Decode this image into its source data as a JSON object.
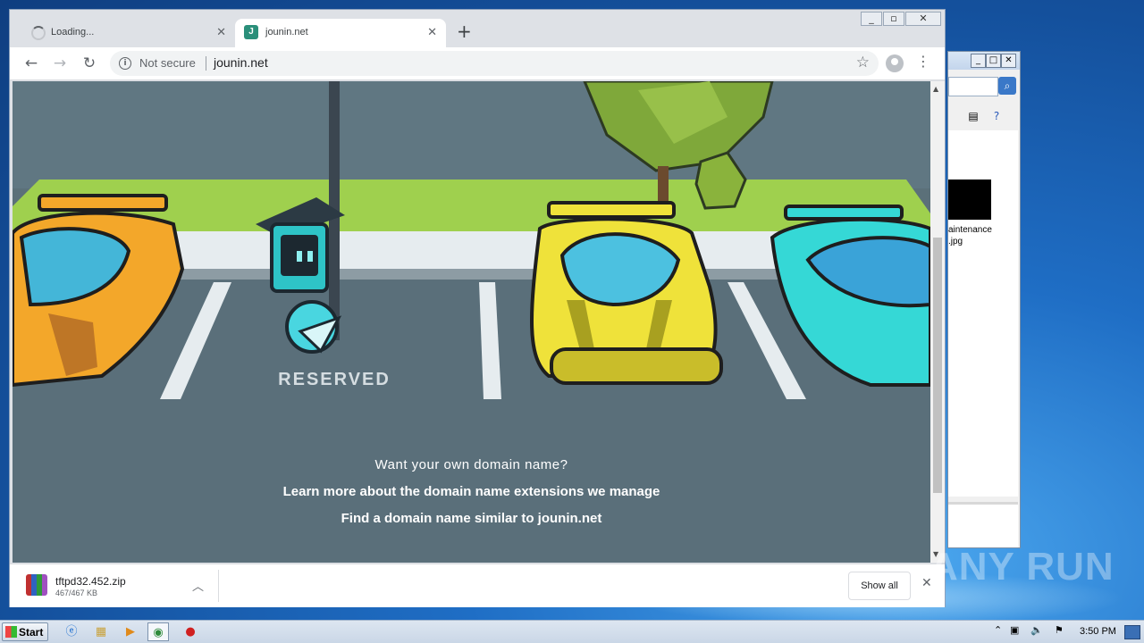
{
  "browser": {
    "tabs": [
      {
        "label": "Loading...",
        "state": "loading"
      },
      {
        "label": "jounin.net",
        "state": "active",
        "favicon": "jounin-logo-icon"
      }
    ],
    "new_tab_label": "+",
    "address": {
      "security_label": "Not secure",
      "url": "jounin.net"
    },
    "window_controls": {
      "minimize": "▭",
      "restore": "⧉",
      "close": "✕"
    }
  },
  "page": {
    "illustration_text": "RESERVED",
    "question": "Want your own domain name?",
    "link1": "Learn more about the domain name extensions we manage",
    "link2": "Find a domain name similar to jounin.net"
  },
  "download": {
    "filename": "tftpd32.452.zip",
    "size": "467/467 KB",
    "show_all": "Show all"
  },
  "background_window": {
    "file_label_line1": "aintenance",
    "file_label_line2": ".jpg"
  },
  "watermark": "ANY RUN",
  "taskbar": {
    "start_label": "Start",
    "clock": "3:50 PM"
  },
  "colors": {
    "asphalt": "#5a6f7a",
    "grass": "#9ccc4c",
    "car_orange": "#f3a72a",
    "car_yellow": "#efe23a",
    "car_cyan": "#35d8d6"
  }
}
